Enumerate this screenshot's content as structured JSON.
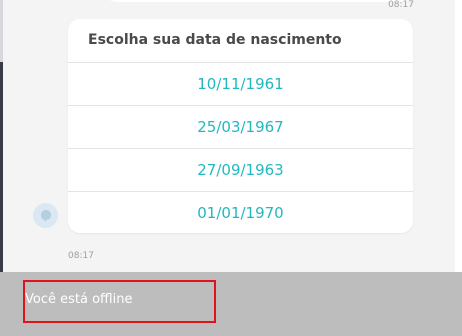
{
  "messages": {
    "top_time": "08:17",
    "bottom_time": "08:17"
  },
  "date_picker": {
    "title": "Escolha sua data de nascimento",
    "options": [
      "10/11/1961",
      "25/03/1967",
      "27/09/1963",
      "01/01/1970"
    ]
  },
  "status": {
    "offline_text": "Você está offline"
  },
  "colors": {
    "option_text": "#22b8c0",
    "offline_bar": "#bdbdbd",
    "highlight_border": "#e0131b"
  },
  "icons": {
    "avatar": "chat-bubble-icon"
  }
}
